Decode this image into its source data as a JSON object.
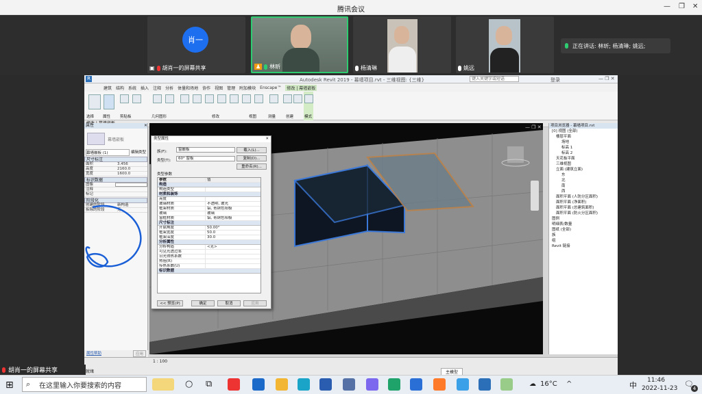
{
  "window": {
    "title": "腾讯会议"
  },
  "participants": [
    {
      "name": "胡肖一的屏幕共享",
      "avatar_text": "肖一"
    },
    {
      "name": "林昕"
    },
    {
      "name": "杨清琳"
    },
    {
      "name": "姚远"
    }
  ],
  "speaking": {
    "text": "正在讲话: 林昕; 杨清琳; 姚远;"
  },
  "revit": {
    "title": "Autodesk Revit 2019 -  幕墙项目.rvt - 三维视图: {三维}",
    "search_placeholder": "键入关键字或短语",
    "user": "登录",
    "tabs": [
      "建筑",
      "结构",
      "系统",
      "插入",
      "注释",
      "分析",
      "体量和场地",
      "协作",
      "视图",
      "管理",
      "附加模块",
      "Enscape™",
      "修改 | 幕墙嵌板"
    ],
    "panels": [
      "选择",
      "属性",
      "剪贴板",
      "几何图形",
      "修改",
      "视图",
      "测量",
      "创建",
      "模式"
    ],
    "context": "修改 | 幕墙嵌板",
    "properties": {
      "header": "属性",
      "family": "幕墙嵌板",
      "type": "幕墙嵌板 (1)",
      "edit_type": "编辑类型",
      "groups": [
        {
          "title": "尺寸标注",
          "rows": [
            [
              "面积",
              "3.456"
            ],
            [
              "高度",
              "2160.0"
            ],
            [
              "宽度",
              "1600.0"
            ]
          ]
        },
        {
          "title": "标识数据",
          "rows": [
            [
              "图像",
              ""
            ],
            [
              "注释",
              ""
            ],
            [
              "标记",
              ""
            ]
          ]
        },
        {
          "title": "阶段化",
          "rows": [
            [
              "创建的阶段",
              "新构造"
            ],
            [
              "拆除的阶段",
              "无"
            ]
          ]
        }
      ],
      "help_link": "属性帮助",
      "apply": "应用"
    },
    "dialog": {
      "title": "类型属性",
      "family_label": "族(F):",
      "family_value": "窗嵌板",
      "type_label": "类型(T):",
      "type_value": "60° 窗板",
      "btn_load": "载入(L)...",
      "btn_duplicate": "复制(D)...",
      "btn_rename": "重命名(R)...",
      "type_params": "类型参数",
      "col_param": "参数",
      "col_value": "值",
      "groups": [
        {
          "title": "构造",
          "rows": [
            [
              "构造类型",
              ""
            ]
          ]
        },
        {
          "title": "材质和装饰",
          "rows": [
            [
              "亮度",
              ""
            ],
            [
              "玻璃材质",
              "不透明, 玻光"
            ],
            [
              "框架材质",
              "铝, 青铜色阳极"
            ],
            [
              "玻璃",
              "玻璃"
            ],
            [
              "窗框材质",
              "铝, 青铜色阳极"
            ]
          ]
        },
        {
          "title": "尺寸标注",
          "rows": [
            [
              "开启角度",
              "50.00°"
            ],
            [
              "框架宽度",
              "50.0"
            ],
            [
              "框架深度",
              "30.0"
            ]
          ]
        },
        {
          "title": "分析属性",
          "rows": [
            [
              "分析构造",
              "<无>"
            ],
            [
              "可见光透过率",
              ""
            ],
            [
              "日光得热系数",
              ""
            ],
            [
              "热阻(R)",
              ""
            ],
            [
              "传热系数(U)",
              ""
            ]
          ]
        },
        {
          "title": "标识数据",
          "rows": []
        }
      ],
      "btn_preview": "<< 预览(P)",
      "btn_ok": "确定",
      "btn_cancel": "取消",
      "btn_apply": "应用"
    },
    "browser": {
      "header": "项目浏览器 - 幕墙项目.rvt",
      "items": [
        "[0] 视图 (全部)",
        "楼层平面",
        "场地",
        "标高 1",
        "标高 2",
        "天花板平面",
        "三维视图",
        "立面 (建筑立面)",
        "东",
        "北",
        "南",
        "西",
        "面积平面 (人防分区面积)",
        "面积平面 (净面积)",
        "面积平面 (总建筑面积)",
        "面积平面 (防火分区面积)",
        "图例",
        "明细表/数量",
        "图纸 (全部)",
        "族",
        "组",
        "Revit 链接"
      ]
    },
    "status": {
      "scale": "1 : 100",
      "left_text": "就绪",
      "model": "主模型"
    }
  },
  "taskbar": {
    "share_label": "胡肖一的屏幕共享",
    "search_placeholder": "在这里输入你要搜索的内容",
    "weather": "16°C",
    "ime": "中",
    "time": "11:46",
    "date": "2022-11-23",
    "notif_count": "4"
  }
}
